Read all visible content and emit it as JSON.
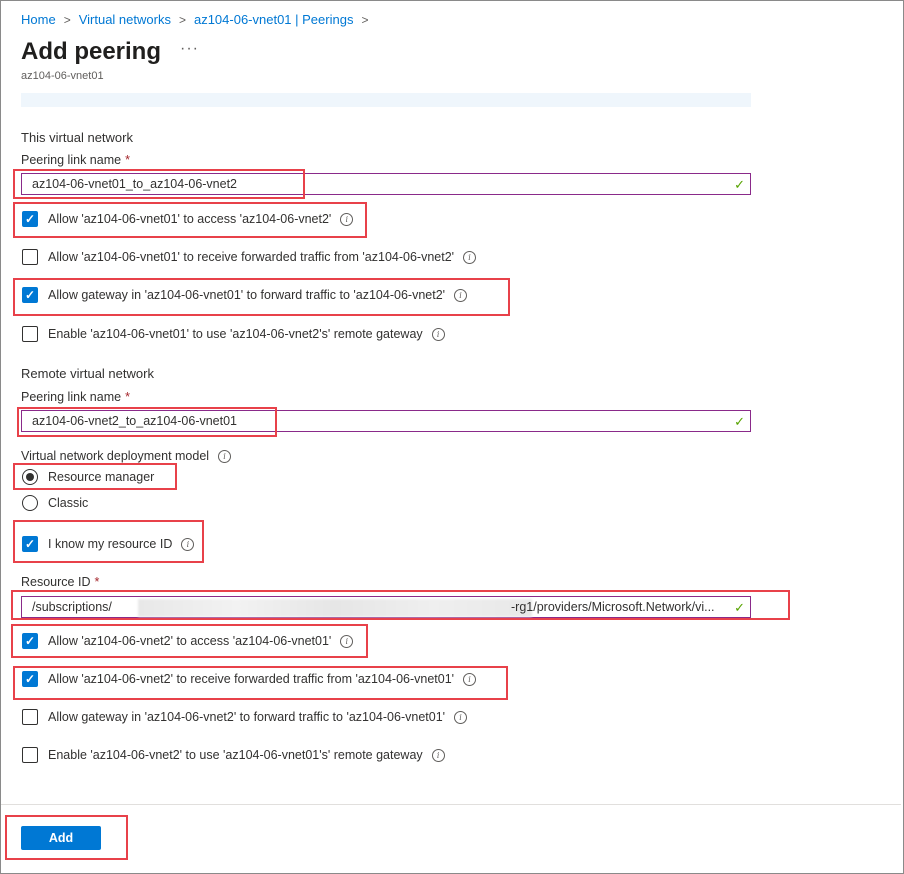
{
  "breadcrumb": {
    "items": [
      "Home",
      "Virtual networks",
      "az104-06-vnet01 | Peerings"
    ],
    "separator": ">"
  },
  "header": {
    "title": "Add peering",
    "more": "···",
    "subtitle": "az104-06-vnet01"
  },
  "this_network": {
    "section_title": "This virtual network",
    "peering_label": "Peering link name",
    "required_mark": "*",
    "peering_value": "az104-06-vnet01_to_az104-06-vnet2",
    "options": [
      {
        "label": "Allow 'az104-06-vnet01' to access 'az104-06-vnet2'",
        "checked": true
      },
      {
        "label": "Allow 'az104-06-vnet01' to receive forwarded traffic from 'az104-06-vnet2'",
        "checked": false
      },
      {
        "label": "Allow gateway in 'az104-06-vnet01' to forward traffic to 'az104-06-vnet2'",
        "checked": true
      },
      {
        "label": "Enable 'az104-06-vnet01' to use 'az104-06-vnet2's' remote gateway",
        "checked": false
      }
    ]
  },
  "remote_network": {
    "section_title": "Remote virtual network",
    "peering_label": "Peering link name",
    "required_mark": "*",
    "peering_value": "az104-06-vnet2_to_az104-06-vnet01",
    "deployment_label": "Virtual network deployment model",
    "deployment_options": [
      {
        "label": "Resource manager",
        "selected": true
      },
      {
        "label": "Classic",
        "selected": false
      }
    ],
    "know_id_label": "I know my resource ID",
    "know_id_checked": true,
    "resource_id_label": "Resource ID",
    "resource_id_prefix": "/subscriptions/",
    "resource_id_suffix": "-rg1/providers/Microsoft.Network/vi...",
    "options": [
      {
        "label": "Allow 'az104-06-vnet2' to access 'az104-06-vnet01'",
        "checked": true
      },
      {
        "label": "Allow 'az104-06-vnet2' to receive forwarded traffic from 'az104-06-vnet01'",
        "checked": true
      },
      {
        "label": "Allow gateway in 'az104-06-vnet2' to forward traffic to 'az104-06-vnet01'",
        "checked": false
      },
      {
        "label": "Enable 'az104-06-vnet2' to use 'az104-06-vnet01's' remote gateway",
        "checked": false
      }
    ]
  },
  "footer": {
    "add_label": "Add"
  },
  "colors": {
    "accent": "#0078d4",
    "highlight": "#e8414a",
    "valid": "#57a300",
    "required": "#a4262c"
  },
  "icons": {
    "info": "info-icon",
    "valid": "checkmark-icon",
    "chevron": "chevron-right-icon"
  }
}
